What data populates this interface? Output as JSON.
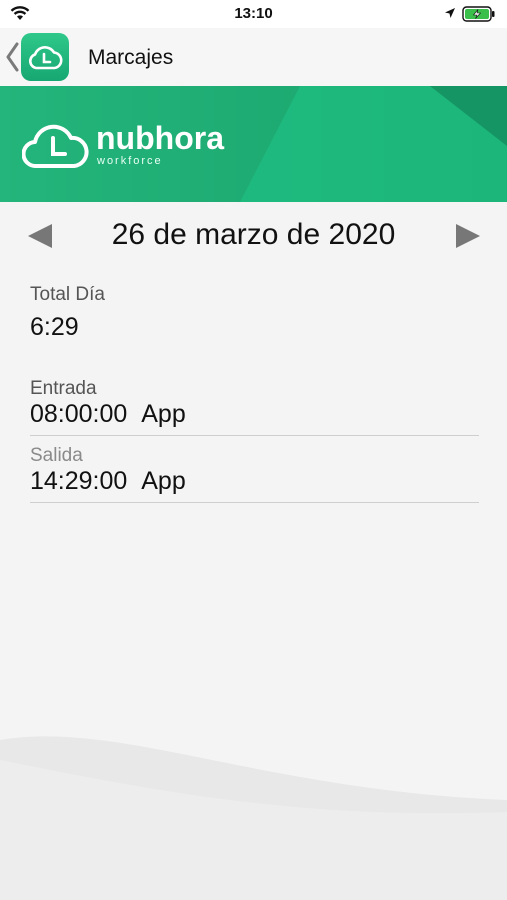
{
  "status_bar": {
    "time": "13:10"
  },
  "nav": {
    "title": "Marcajes"
  },
  "banner": {
    "brand": "nubhora",
    "tagline": "workforce"
  },
  "date_nav": {
    "date": "26 de marzo de  2020"
  },
  "total": {
    "label": "Total Día",
    "value": "6:29"
  },
  "punches": [
    {
      "label": "Entrada",
      "time": "08:00:00",
      "source": "App"
    },
    {
      "label": "Salida",
      "time": "14:29:00",
      "source": "App"
    }
  ],
  "colors": {
    "brand_green": "#1ebc80",
    "banner_dark": "#16935f"
  }
}
